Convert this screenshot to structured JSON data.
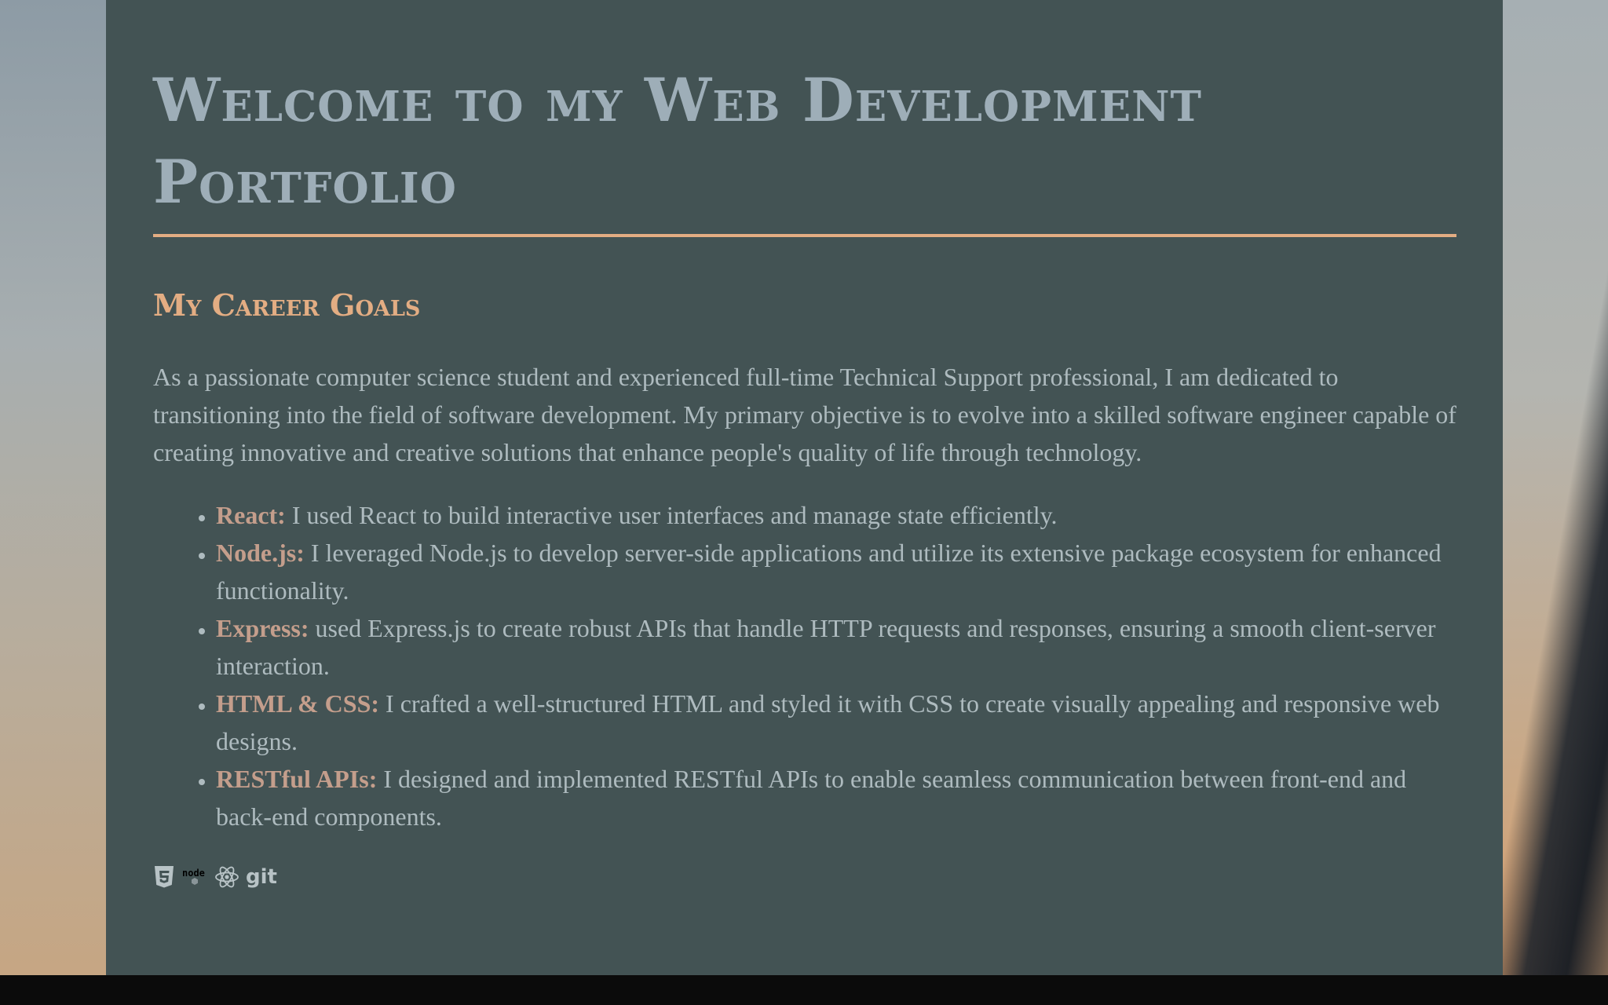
{
  "page": {
    "title": "Welcome to my Web Development Portfolio"
  },
  "goals": {
    "heading": "My Career Goals",
    "intro": "As a passionate computer science student and experienced full-time Technical Support professional, I am dedicated to transitioning into the field of software development. My primary objective is to evolve into a skilled software engineer capable of creating innovative and creative solutions that enhance people's quality of life through technology.",
    "skills": [
      {
        "name": "React:",
        "text": " I used React to build interactive user interfaces and manage state efficiently."
      },
      {
        "name": "Node.js:",
        "text": " I leveraged Node.js to develop server-side applications and utilize its extensive package ecosystem for enhanced functionality."
      },
      {
        "name": "Express:",
        "text": " used Express.js to create robust APIs that handle HTTP requests and responses, ensuring a smooth client-server interaction."
      },
      {
        "name": "HTML & CSS:",
        "text": " I crafted a well-structured HTML and styled it with CSS to create visually appealing and responsive web designs."
      },
      {
        "name": "RESTful APIs:",
        "text": " I designed and implemented RESTful APIs to enable seamless communication between front-end and back-end components."
      }
    ]
  },
  "tech_icons": {
    "items": [
      "html5-icon",
      "nodejs-icon",
      "react-icon",
      "git-icon"
    ],
    "nodejs_label": "node",
    "git_label": "git"
  },
  "colors": {
    "panel_bg": "#435354",
    "accent": "#e3ad83",
    "title": "#9eaeb8",
    "body_text": "#aebbbf",
    "skill_name": "#c49e8c"
  }
}
